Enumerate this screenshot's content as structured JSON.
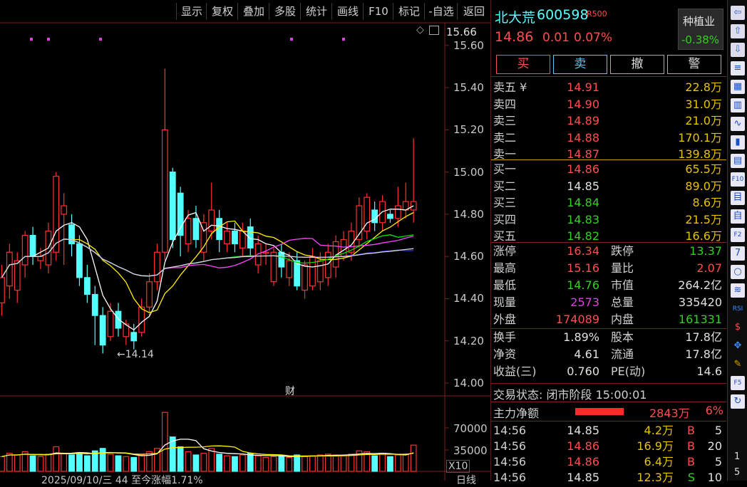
{
  "toolbar": [
    "显示",
    "复权",
    "叠加",
    "多股",
    "统计",
    "画线",
    "F10",
    "标记",
    "-自选",
    "返回"
  ],
  "chart": {
    "top_price": "15.66",
    "y_labels": [
      "15.60",
      "15.40",
      "15.20",
      "15.00",
      "14.80",
      "14.60",
      "14.40",
      "14.20",
      "14.00"
    ],
    "low_marker": "←14.14",
    "fin_marker": "财",
    "vol_labels": [
      "70000",
      "35000"
    ],
    "vol_unit": "X10",
    "status_text": "2025/09/10/三 44 至今涨幅1.71%",
    "period_text": "日线",
    "colors": {
      "up": "#ff3030",
      "down": "#54ffff",
      "ma5": "#ffffff",
      "ma10": "#ffee00",
      "ma20": "#ff44ff",
      "ma30": "#00e000",
      "ma60": "#3030ff",
      "ma120": "#d8d8d8",
      "vol_ma1": "#ffffff",
      "vol_ma2": "#ffee00"
    },
    "candles": [
      {
        "o": 14.38,
        "c": 14.5,
        "h": 14.56,
        "l": 14.32
      },
      {
        "o": 14.46,
        "c": 14.62,
        "h": 14.66,
        "l": 14.4
      },
      {
        "o": 14.44,
        "c": 14.58,
        "h": 14.62,
        "l": 14.38
      },
      {
        "o": 14.56,
        "c": 14.7,
        "h": 14.72,
        "l": 14.5
      },
      {
        "o": 14.7,
        "c": 14.6,
        "h": 14.74,
        "l": 14.56
      },
      {
        "o": 14.58,
        "c": 14.6,
        "h": 14.64,
        "l": 14.54
      },
      {
        "o": 14.56,
        "c": 14.72,
        "h": 14.76,
        "l": 14.52
      },
      {
        "o": 14.62,
        "c": 14.98,
        "h": 15.0,
        "l": 14.58
      },
      {
        "o": 14.8,
        "c": 14.84,
        "h": 14.9,
        "l": 14.56
      },
      {
        "o": 14.75,
        "c": 14.66,
        "h": 14.8,
        "l": 14.6
      },
      {
        "o": 14.66,
        "c": 14.5,
        "h": 14.7,
        "l": 14.46
      },
      {
        "o": 14.5,
        "c": 14.42,
        "h": 14.56,
        "l": 14.38
      },
      {
        "o": 14.42,
        "c": 14.32,
        "h": 14.46,
        "l": 14.18
      },
      {
        "o": 14.32,
        "c": 14.18,
        "h": 14.36,
        "l": 14.14
      },
      {
        "o": 14.22,
        "c": 14.34,
        "h": 14.38,
        "l": 14.2
      },
      {
        "o": 14.34,
        "c": 14.26,
        "h": 14.38,
        "l": 14.22
      },
      {
        "o": 14.22,
        "c": 14.28,
        "h": 14.3,
        "l": 14.18
      },
      {
        "o": 14.24,
        "c": 14.2,
        "h": 14.28,
        "l": 14.16
      },
      {
        "o": 14.24,
        "c": 14.36,
        "h": 14.4,
        "l": 14.22
      },
      {
        "o": 14.36,
        "c": 14.48,
        "h": 14.52,
        "l": 14.32
      },
      {
        "o": 14.48,
        "c": 14.62,
        "h": 14.66,
        "l": 14.44
      },
      {
        "o": 14.62,
        "c": 15.2,
        "h": 15.49,
        "l": 14.58
      },
      {
        "o": 15.0,
        "c": 14.68,
        "h": 15.02,
        "l": 14.64
      },
      {
        "o": 14.9,
        "c": 14.7,
        "h": 14.93,
        "l": 14.6
      },
      {
        "o": 14.66,
        "c": 14.78,
        "h": 14.82,
        "l": 14.62
      },
      {
        "o": 14.78,
        "c": 14.68,
        "h": 14.84,
        "l": 14.64
      },
      {
        "o": 14.62,
        "c": 14.76,
        "h": 14.8,
        "l": 14.58
      },
      {
        "o": 14.72,
        "c": 14.82,
        "h": 14.95,
        "l": 14.68
      },
      {
        "o": 14.78,
        "c": 14.68,
        "h": 14.82,
        "l": 14.62
      },
      {
        "o": 14.66,
        "c": 14.72,
        "h": 14.76,
        "l": 14.62
      },
      {
        "o": 14.72,
        "c": 14.66,
        "h": 14.76,
        "l": 14.62
      },
      {
        "o": 14.64,
        "c": 14.72,
        "h": 14.76,
        "l": 14.6
      },
      {
        "o": 14.74,
        "c": 14.64,
        "h": 14.78,
        "l": 14.6
      },
      {
        "o": 14.56,
        "c": 14.66,
        "h": 14.7,
        "l": 14.52
      },
      {
        "o": 14.62,
        "c": 14.62,
        "h": 14.66,
        "l": 14.56
      },
      {
        "o": 14.48,
        "c": 14.62,
        "h": 14.64,
        "l": 14.46
      },
      {
        "o": 14.62,
        "c": 14.55,
        "h": 14.66,
        "l": 14.5
      },
      {
        "o": 14.5,
        "c": 14.58,
        "h": 14.62,
        "l": 14.46
      },
      {
        "o": 14.58,
        "c": 14.46,
        "h": 14.62,
        "l": 14.44
      },
      {
        "o": 14.44,
        "c": 14.56,
        "h": 14.58,
        "l": 14.4
      },
      {
        "o": 14.46,
        "c": 14.6,
        "h": 14.64,
        "l": 14.44
      },
      {
        "o": 14.48,
        "c": 14.58,
        "h": 14.62,
        "l": 14.44
      },
      {
        "o": 14.5,
        "c": 14.62,
        "h": 14.66,
        "l": 14.46
      },
      {
        "o": 14.55,
        "c": 14.67,
        "h": 14.7,
        "l": 14.5
      },
      {
        "o": 14.6,
        "c": 14.68,
        "h": 14.72,
        "l": 14.58
      },
      {
        "o": 14.62,
        "c": 14.72,
        "h": 14.76,
        "l": 14.58
      },
      {
        "o": 14.68,
        "c": 14.84,
        "h": 14.88,
        "l": 14.64
      },
      {
        "o": 14.72,
        "c": 14.88,
        "h": 14.9,
        "l": 14.68
      },
      {
        "o": 14.82,
        "c": 14.76,
        "h": 14.86,
        "l": 14.72
      },
      {
        "o": 14.76,
        "c": 14.86,
        "h": 14.89,
        "l": 14.72
      },
      {
        "o": 14.8,
        "c": 14.78,
        "h": 14.82,
        "l": 14.76
      },
      {
        "o": 14.78,
        "c": 14.84,
        "h": 14.93,
        "l": 14.74
      },
      {
        "o": 14.82,
        "c": 14.86,
        "h": 14.95,
        "l": 14.78
      },
      {
        "o": 14.82,
        "c": 14.86,
        "h": 15.16,
        "l": 14.76
      }
    ],
    "volumes": [
      18,
      22,
      20,
      24,
      19,
      18,
      21,
      30,
      22,
      20,
      22,
      19,
      25,
      28,
      21,
      19,
      18,
      17,
      20,
      24,
      28,
      72,
      42,
      30,
      24,
      20,
      22,
      28,
      21,
      19,
      18,
      20,
      22,
      19,
      17,
      18,
      19,
      17,
      20,
      18,
      19,
      20,
      21,
      20,
      19,
      21,
      25,
      24,
      19,
      22,
      18,
      20,
      21,
      32
    ]
  },
  "quote": {
    "name": "北大荒",
    "code": "600598",
    "badge": "R500",
    "price": "14.86",
    "change": "0.01",
    "pct": "0.07%",
    "sector": "种植业",
    "sector_pct": "-0.38%",
    "buttons": [
      "买",
      "卖",
      "撤",
      "警"
    ],
    "asks": [
      {
        "label": "卖五 ¥",
        "price": "14.91",
        "vol": "22.8万"
      },
      {
        "label": "卖四",
        "price": "14.90",
        "vol": "31.0万"
      },
      {
        "label": "卖三",
        "price": "14.89",
        "vol": "21.0万"
      },
      {
        "label": "卖二",
        "price": "14.88",
        "vol": "170.1万"
      },
      {
        "label": "卖一",
        "price": "14.87",
        "vol": "139.8万"
      }
    ],
    "bids": [
      {
        "label": "买一",
        "price": "14.86",
        "vol": "65.5万",
        "pc": "red"
      },
      {
        "label": "买二",
        "price": "14.85",
        "vol": "89.0万",
        "pc": "white"
      },
      {
        "label": "买三",
        "price": "14.84",
        "vol": "8.6万",
        "pc": "green"
      },
      {
        "label": "买四",
        "price": "14.83",
        "vol": "21.5万",
        "pc": "green"
      },
      {
        "label": "买五",
        "price": "14.82",
        "vol": "16.6万",
        "pc": "green"
      }
    ],
    "stats": [
      {
        "k1": "涨停",
        "v1": "16.34",
        "c1": "red",
        "k2": "跌停",
        "v2": "13.37",
        "c2": "green"
      },
      {
        "k1": "最高",
        "v1": "15.16",
        "c1": "red",
        "k2": "量比",
        "v2": "2.07",
        "c2": "red"
      },
      {
        "k1": "最低",
        "v1": "14.76",
        "c1": "green",
        "k2": "市值",
        "v2": "264.2亿",
        "c2": "white"
      },
      {
        "k1": "现量",
        "v1": "2573",
        "c1": "magenta",
        "k2": "总量",
        "v2": "335420",
        "c2": "white"
      },
      {
        "k1": "外盘",
        "v1": "174089",
        "c1": "red",
        "k2": "内盘",
        "v2": "161331",
        "c2": "green"
      }
    ],
    "fund": [
      {
        "k1": "换手",
        "v1": "1.89%",
        "k2": "股本",
        "v2": "17.8亿"
      },
      {
        "k1": "净资",
        "v1": "4.61",
        "k2": "流通",
        "v2": "17.8亿"
      },
      {
        "k1": "收益(三)",
        "v1": "0.760",
        "k2": "PE(动)",
        "v2": "14.6"
      }
    ],
    "trade_status": "交易状态: 闭市阶段 15:00:01",
    "main_flow_label": "主力净额",
    "main_flow_value": "2843万",
    "main_flow_pct": "6%",
    "ticks": [
      {
        "t": "14:56",
        "p": "14.85",
        "pc": "white",
        "v": "4.2万",
        "s": "B",
        "sc": "red",
        "n": "5"
      },
      {
        "t": "14:56",
        "p": "14.86",
        "pc": "red",
        "v": "16.9万",
        "s": "B",
        "sc": "red",
        "n": "20"
      },
      {
        "t": "14:56",
        "p": "14.86",
        "pc": "red",
        "v": "6.4万",
        "s": "B",
        "sc": "red",
        "n": "5"
      },
      {
        "t": "14:56",
        "p": "14.85",
        "pc": "white",
        "v": "12.3万",
        "s": "S",
        "sc": "green",
        "n": "10"
      }
    ]
  },
  "sidebar": {
    "icons": [
      "arrow-left-icon",
      "arrow-up-icon",
      "arrow-down-icon",
      "list-icon",
      "grid-icon",
      "bar-chart-icon",
      "trend-icon",
      "candle-icon",
      "table-icon",
      "f10-icon",
      "doc-icon",
      "self-icon",
      "f2-icon",
      "analyze-icon",
      "circle-icon",
      "wave-icon",
      "rsi-icon",
      "dollar-icon",
      "move-icon",
      "pencil-icon",
      "f5-icon",
      "refresh-icon"
    ],
    "page_numbers": [
      "1",
      "5"
    ]
  }
}
